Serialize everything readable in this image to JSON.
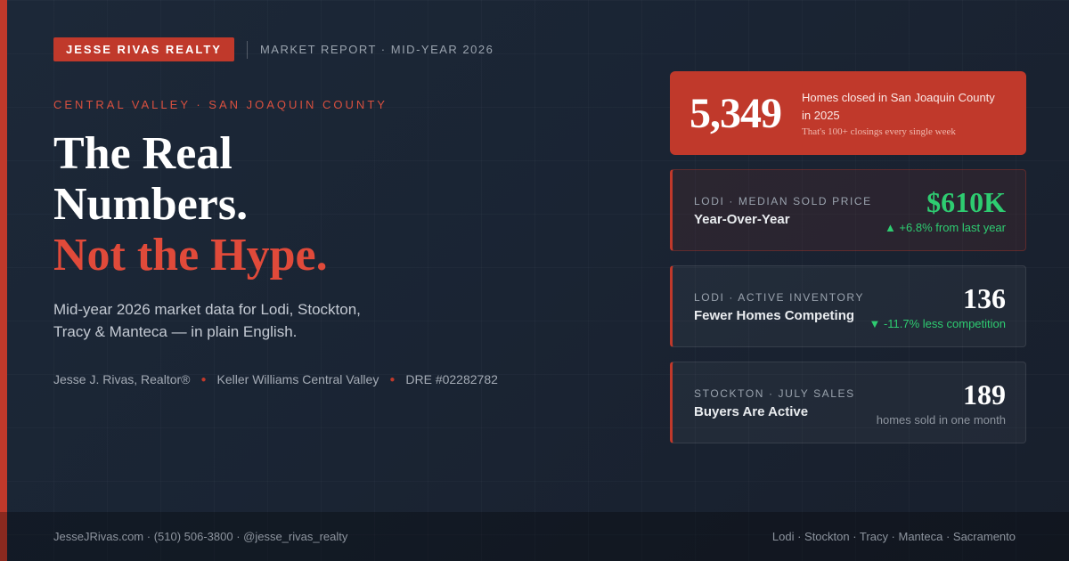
{
  "brand": {
    "name": "JESSE RIVAS REALTY",
    "report": "MARKET REPORT · MID-YEAR 2026"
  },
  "region": "CENTRAL VALLEY · SAN JOAQUIN COUNTY",
  "headline": {
    "line1": "The Real",
    "line2": "Numbers.",
    "accent": "Not the Hype."
  },
  "subtext": "Mid-year 2026 market data for Lodi, Stockton, Tracy & Manteca — in plain English.",
  "credits": {
    "agent": "Jesse J. Rivas, Realtor®",
    "brokerage": "Keller Williams Central Valley",
    "license": "DRE #02282782"
  },
  "hero": {
    "value": "5,349",
    "desc": "Homes closed in San Joaquin County in 2025",
    "note": "That's 100+ closings every single week"
  },
  "stats": [
    {
      "label": "LODI · MEDIAN SOLD PRICE",
      "sub": "Year-Over-Year",
      "value": "$610K",
      "change": "▲ +6.8% from last year"
    },
    {
      "label": "LODI · ACTIVE INVENTORY",
      "sub": "Fewer Homes Competing",
      "value": "136",
      "change": "▼ -11.7% less competition"
    },
    {
      "label": "STOCKTON · JULY SALES",
      "sub": "Buyers Are Active",
      "value": "189",
      "change": "homes sold in one month"
    }
  ],
  "footer": {
    "contact": "JesseJRivas.com · (510) 506-3800 · @jesse_rivas_realty",
    "areas": "Lodi · Stockton · Tracy · Manteca · Sacramento"
  },
  "colors": {
    "accent": "#c0392b",
    "positive": "#2ecc71",
    "background": "#1c2838"
  }
}
